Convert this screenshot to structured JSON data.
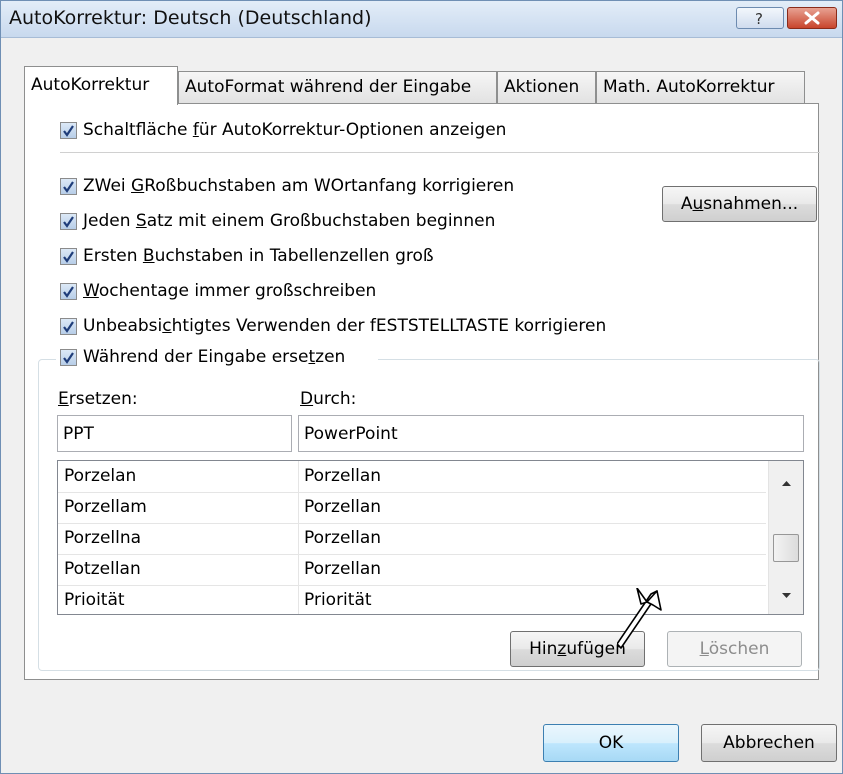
{
  "window": {
    "title": "AutoKorrektur: Deutsch (Deutschland)"
  },
  "titlebar_buttons": {
    "help": "?",
    "close": "X"
  },
  "tabs": [
    {
      "label": "AutoKorrektur",
      "active": true
    },
    {
      "label": "AutoFormat während der Eingabe",
      "active": false
    },
    {
      "label": "Aktionen",
      "active": false
    },
    {
      "label": "Math. AutoKorrektur",
      "active": false
    }
  ],
  "options": {
    "show_button": {
      "pre": "Schaltfläche ",
      "u": "f",
      "post": "ür AutoKorrektur-Optionen anzeigen",
      "checked": true
    },
    "two_caps": {
      "pre": "ZWei ",
      "u": "G",
      "post": "Roßbuchstaben am WOrtanfang korrigieren",
      "checked": true
    },
    "sentence": {
      "pre": "Jeden ",
      "u": "S",
      "post": "atz mit einem Großbuchstaben beginnen",
      "checked": true
    },
    "table_cells": {
      "pre": "Ersten ",
      "u": "B",
      "post": "uchstaben in Tabellenzellen groß",
      "checked": true
    },
    "weekdays": {
      "pre": "",
      "u": "W",
      "post": "ochentage immer großschreiben",
      "checked": true
    },
    "capslock": {
      "pre": "Unbeabsi",
      "u": "c",
      "post": "htigtes Verwenden der fESTSTELLTASTE korrigieren",
      "checked": true
    },
    "replace_typing": {
      "pre": "Während der Eingabe erse",
      "u": "t",
      "post": "zen",
      "checked": true
    }
  },
  "exceptions_button": {
    "pre": "A",
    "u": "u",
    "post": "snahmen..."
  },
  "replace": {
    "label_replace": {
      "u": "E",
      "post": "rsetzen:"
    },
    "label_with": {
      "u": "D",
      "post": "urch:"
    },
    "replace_value": "PPT",
    "with_value": "PowerPoint"
  },
  "list": {
    "rows": [
      [
        "Porzelan",
        "Porzellan"
      ],
      [
        "Porzellam",
        "Porzellan"
      ],
      [
        "Porzellna",
        "Porzellan"
      ],
      [
        "Potzellan",
        "Porzellan"
      ],
      [
        "Prioität",
        "Priorität"
      ]
    ]
  },
  "add_button": {
    "pre": "Hin",
    "u": "z",
    "post": "ufügen"
  },
  "delete_button": {
    "pre": "",
    "u": "L",
    "post": "öschen"
  },
  "ok_button": "OK",
  "cancel_button": "Abbrechen",
  "colors": {
    "title_gradient_top": "#e3edf8",
    "close_red": "#c8452c",
    "focus_blue": "#3c7fb1"
  }
}
